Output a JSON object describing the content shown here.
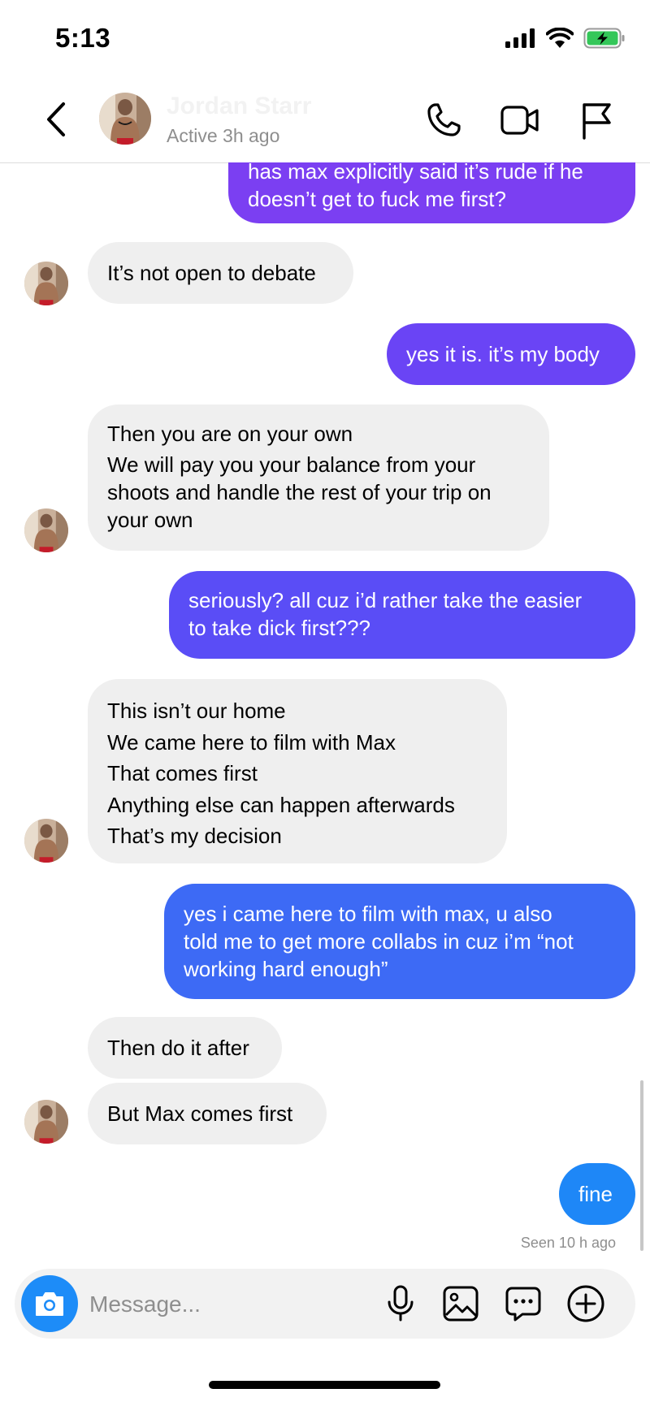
{
  "status_bar": {
    "time": "5:13"
  },
  "header": {
    "contact_name": "Jordan Starr",
    "contact_status": "Active 3h ago"
  },
  "messages": [
    {
      "sender": "me",
      "lines": [
        "has max explicitly said it’s rude if he",
        "doesn’t get to fuck me first?"
      ]
    },
    {
      "sender": "them",
      "lines": [
        "It’s not open to debate"
      ]
    },
    {
      "sender": "me",
      "lines": [
        "yes it is. it’s my body"
      ]
    },
    {
      "sender": "them",
      "lines": [
        "Then you are on your own",
        "We will pay you your balance from your",
        "shoots and handle the rest of your trip on",
        "your own"
      ]
    },
    {
      "sender": "me",
      "lines": [
        "seriously? all cuz i’d rather take the easier",
        "to take dick first???"
      ]
    },
    {
      "sender": "them",
      "lines": [
        "This isn’t our home",
        "We came here to film with Max",
        "That comes first",
        "Anything else can happen afterwards",
        "That’s my decision"
      ]
    },
    {
      "sender": "me",
      "lines": [
        "yes i came here to film with max, u also",
        "told me to get more collabs in cuz i’m “not",
        "working hard enough”"
      ]
    },
    {
      "sender": "them",
      "lines": [
        "Then do it after"
      ]
    },
    {
      "sender": "them",
      "lines": [
        "But Max comes first"
      ]
    },
    {
      "sender": "me",
      "lines": [
        "fine"
      ]
    }
  ],
  "seen_status": "Seen 10 h ago",
  "composer": {
    "placeholder": "Message..."
  },
  "icons": {
    "back": "chevron-left-icon",
    "call": "phone-icon",
    "video": "video-camera-icon",
    "report": "flag-icon",
    "camera": "camera-icon",
    "mic": "microphone-icon",
    "gallery": "image-icon",
    "sticker": "chat-bubble-icon",
    "add": "plus-circle-icon"
  },
  "colors": {
    "incoming_bubble": "#efefef",
    "outgoing_gradient": [
      "#7b3ff2",
      "#6a44f5",
      "#5a4df6",
      "#4a5bf6",
      "#3d6af5",
      "#1e87f7"
    ],
    "camera_button": "#1d8cf8",
    "battery": "#34c759"
  }
}
